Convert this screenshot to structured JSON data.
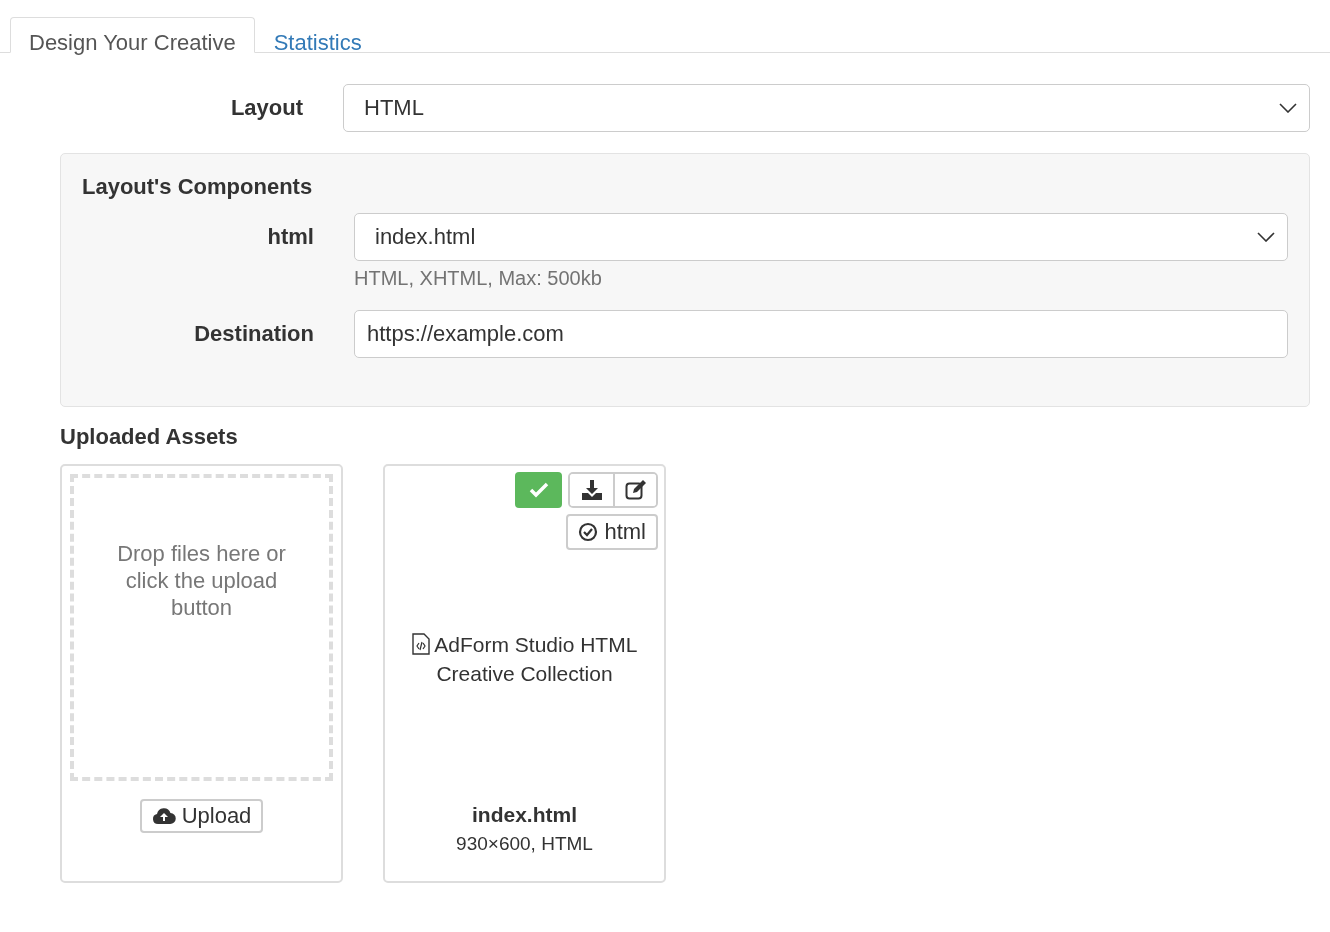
{
  "tabs": [
    {
      "label": "Design Your Creative",
      "selected": true
    },
    {
      "label": "Statistics",
      "selected": false
    }
  ],
  "layout_field": {
    "label": "Layout",
    "value": "HTML"
  },
  "components_panel": {
    "title": "Layout's Components",
    "fields": [
      {
        "kind": "select",
        "label": "html",
        "value": "index.html",
        "help": "HTML, XHTML, Max: 500kb"
      },
      {
        "kind": "text",
        "label": "Destination",
        "value": "https://example.com"
      }
    ]
  },
  "uploaded_assets": {
    "title": "Uploaded Assets",
    "dropzone": {
      "text": "Drop files here or click the upload button",
      "button": "Upload"
    },
    "assets": [
      {
        "approved": true,
        "component_tag": "html",
        "title": "AdForm Studio HTML Creative Collection",
        "filename": "index.html",
        "meta": "930×600, HTML"
      }
    ]
  }
}
